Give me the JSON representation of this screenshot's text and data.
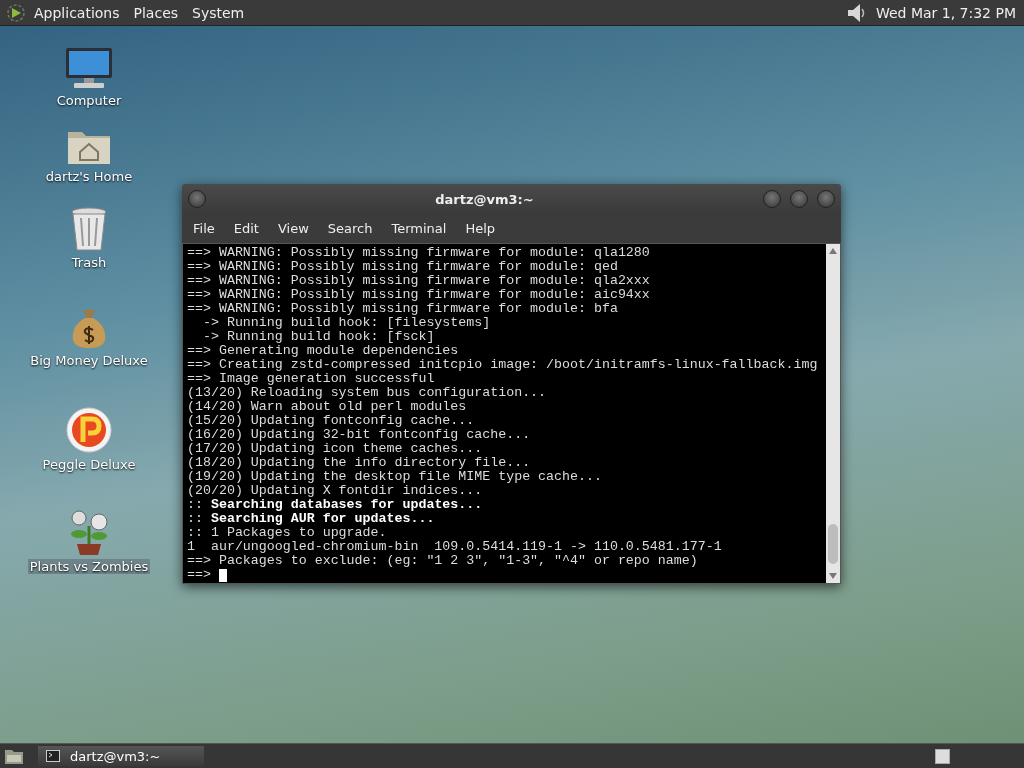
{
  "top_panel": {
    "menus": [
      "Applications",
      "Places",
      "System"
    ],
    "clock": "Wed Mar  1,  7:32 PM"
  },
  "desktop_icons": [
    {
      "kind": "computer",
      "label": "Computer"
    },
    {
      "kind": "home",
      "label": "dartz's Home"
    },
    {
      "kind": "trash",
      "label": "Trash"
    },
    {
      "kind": "money",
      "label": "Big Money Deluxe"
    },
    {
      "kind": "peggle",
      "label": "Peggle Deluxe"
    },
    {
      "kind": "plant",
      "label": "Plants vs Zombies"
    }
  ],
  "window": {
    "title": "dartz@vm3:~",
    "menus": [
      "File",
      "Edit",
      "View",
      "Search",
      "Terminal",
      "Help"
    ],
    "lines": [
      "==> WARNING: Possibly missing firmware for module: qla1280",
      "==> WARNING: Possibly missing firmware for module: qed",
      "==> WARNING: Possibly missing firmware for module: qla2xxx",
      "==> WARNING: Possibly missing firmware for module: aic94xx",
      "==> WARNING: Possibly missing firmware for module: bfa",
      "  -> Running build hook: [filesystems]",
      "  -> Running build hook: [fsck]",
      "==> Generating module dependencies",
      "==> Creating zstd-compressed initcpio image: /boot/initramfs-linux-fallback.img",
      "==> Image generation successful",
      "(13/20) Reloading system bus configuration...",
      "(14/20) Warn about old perl modules",
      "(15/20) Updating fontconfig cache...",
      "(16/20) Updating 32-bit fontconfig cache...",
      "(17/20) Updating icon theme caches...",
      "(18/20) Updating the info directory file...",
      "(19/20) Updating the desktop file MIME type cache...",
      "(20/20) Updating X fontdir indices...",
      ":: **Searching databases for updates...**",
      ":: **Searching AUR for updates...**",
      ":: 1 Packages to upgrade.",
      "1  aur/ungoogled-chromium-bin  109.0.5414.119-1 -> 110.0.5481.177-1",
      "==> Packages to exclude: (eg: \"1 2 3\", \"1-3\", \"^4\" or repo name)"
    ],
    "prompt": {
      "text": "==>",
      "cursor": true
    }
  },
  "bottom_panel": {
    "tasks": [
      {
        "label": "dartz@vm3:~",
        "selected": true
      }
    ]
  }
}
